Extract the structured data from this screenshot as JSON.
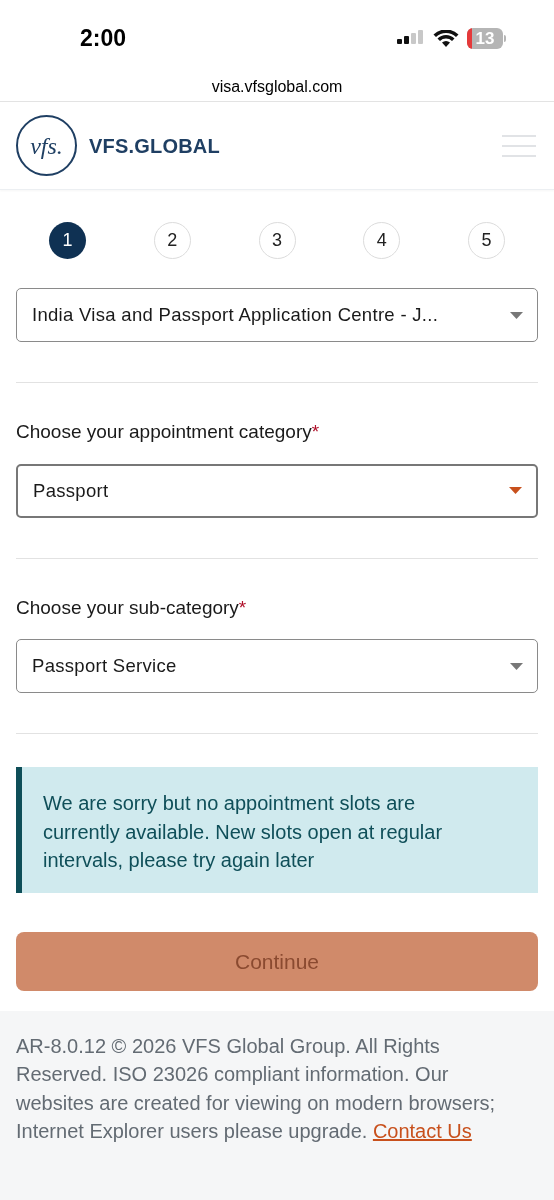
{
  "status_bar": {
    "time": "2:00",
    "battery": "13"
  },
  "browser": {
    "url": "visa.vfsglobal.com"
  },
  "header": {
    "logo_mark": "vfs.",
    "logo_text": "VFS.GLOBAL"
  },
  "steps": [
    {
      "label": "1",
      "selected": true
    },
    {
      "label": "2",
      "selected": false
    },
    {
      "label": "3",
      "selected": false
    },
    {
      "label": "4",
      "selected": false
    },
    {
      "label": "5",
      "selected": false
    }
  ],
  "fields": [
    {
      "value": "India Visa and Passport Application Centre - J...",
      "focused": false
    },
    {
      "label": "Choose your appointment category",
      "required": "*",
      "value": "Passport",
      "focused": true
    },
    {
      "label": "Choose your sub-category",
      "required": "*",
      "value": "Passport Service",
      "focused": false
    }
  ],
  "alert": {
    "text": "We are sorry but no appointment slots are currently available. New slots open at regular intervals, please try again later"
  },
  "continue_button": {
    "label": "Continue",
    "disabled": true
  },
  "footer": {
    "text": "AR-8.0.12 © 2026 VFS Global Group. All Rights Reserved. ISO 23026 compliant information. Our websites are created for viewing on modern browsers; Internet Explorer users please upgrade.",
    "link": "Contact Us"
  }
}
